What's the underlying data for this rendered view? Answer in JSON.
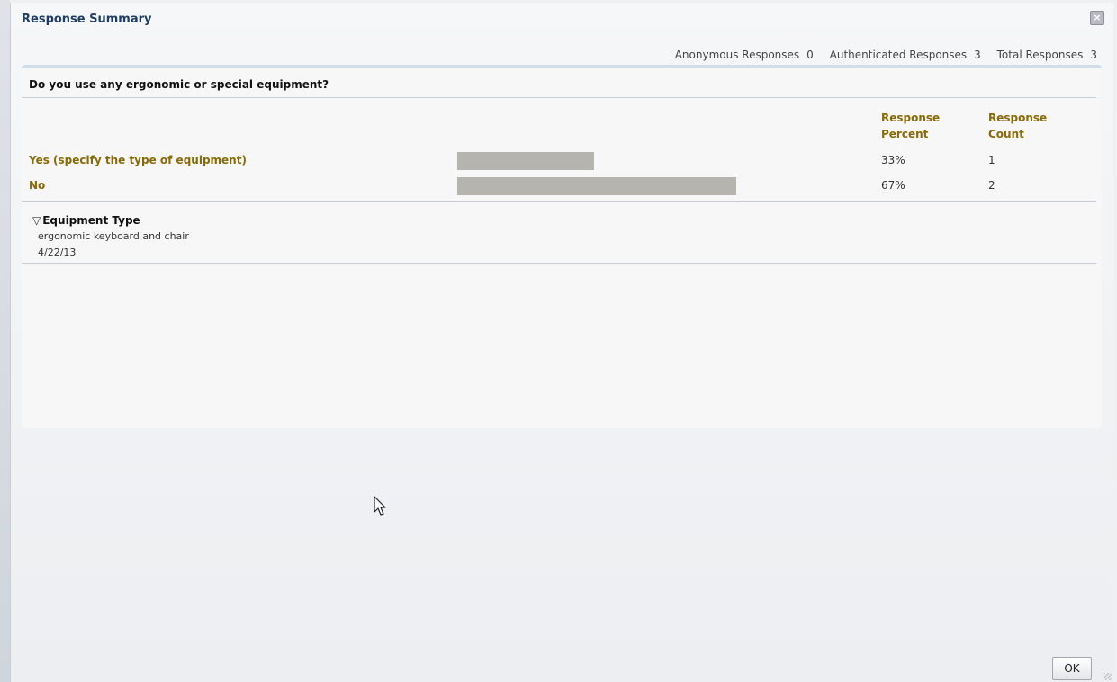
{
  "dialog": {
    "title": "Response Summary",
    "close_icon": "close-icon",
    "ok_label": "OK"
  },
  "stats": {
    "anonymous_label": "Anonymous Responses",
    "anonymous_value": "0",
    "authenticated_label": "Authenticated Responses",
    "authenticated_value": "3",
    "total_label": "Total Responses",
    "total_value": "3"
  },
  "question": {
    "text": "Do you use any ergonomic or special equipment?",
    "col_percent": "Response Percent",
    "col_count": "Response Count",
    "bar_color": "#b5b4af",
    "answers": [
      {
        "label": "Yes (specify the type of equipment)",
        "percent": "33%",
        "fraction": 0.33,
        "count": "1"
      },
      {
        "label": "No",
        "percent": "67%",
        "fraction": 0.67,
        "count": "2"
      }
    ]
  },
  "details": {
    "heading": "Equipment Type",
    "toggle_icon": "collapse-triangle-icon",
    "entries": [
      {
        "text": "ergonomic keyboard and chair",
        "date": "4/22/13"
      }
    ]
  }
}
